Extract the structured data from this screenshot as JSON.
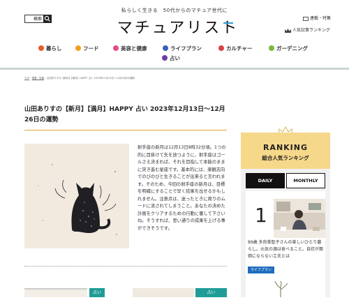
{
  "header": {
    "search_label": "検索",
    "search_icon": "search-icon",
    "tagline": "私らしく生きる　50代からのマチュア世代に",
    "logo": "マチュアリスト",
    "feature_link": "連載・特集",
    "ranking_link": "人気記事ランキング"
  },
  "nav": {
    "items": [
      {
        "label": "暮らし",
        "color": "#e85a2c"
      },
      {
        "label": "フード",
        "color": "#f0a020"
      },
      {
        "label": "美容と健康",
        "color": "#e44a8a"
      },
      {
        "label": "ライフプラン",
        "color": "#3a5fb8"
      },
      {
        "label": "カルチャー",
        "color": "#d9404a"
      },
      {
        "label": "ガーデニング",
        "color": "#7ab73a"
      },
      {
        "label": "占い",
        "color": "#6b3fa0"
      }
    ]
  },
  "breadcrumb": {
    "top": "TOP",
    "sep1": "›",
    "category": "連載・特集",
    "sep2": "›",
    "current": "山田ありすの【新月】【満月】HAPPY 占い 2023年12月13日〜12月26日の運勢"
  },
  "article": {
    "title": "山田ありすの【新月】【満月】HAPPY 占い 2023年12月13日〜12月26日の運勢",
    "body": "射手座の新月は12月13日8時32分頃。1つの的に目掛けて矢を放つように、射手座はゴールさえ決まれば、それを目指して本能のままに突き進む星座です。基本的には、楽観志向でのびのびと生きることが出来ると言われます。そのため、今回の射手座の新月は、目標を明確にすることで早く結果を出せるかもしれません。注意点は、迷ったときに周りのムードに流されてしまうこと。あなたの決めた計画をクリアするための行動に徹して下さいね。そうすれば、思い通りの成果を上げる事ができそうです。"
  },
  "thumbs": [
    {
      "label": "",
      "color": "#1e9c96"
    },
    {
      "label": "占い",
      "color": "#1e9c96"
    },
    {
      "label": "占い",
      "color": "#1e9c96"
    }
  ],
  "sidebar": {
    "ranking_title": "RANKING",
    "ranking_subtitle": "総合人気ランキング",
    "tab_daily": "DAILY",
    "tab_monthly": "MONTHLY",
    "top_item": {
      "rank": "1",
      "text": "89歳 多良美智子さんの楽しいひとり暮らし。元気の源は食べること。自炊が面倒にならない工夫とは",
      "tag": "ライフプラン"
    }
  },
  "colors": {
    "accent_gold": "#e2a63c",
    "ranking_bg": "#f6d88a",
    "teal": "#1e9c96"
  }
}
